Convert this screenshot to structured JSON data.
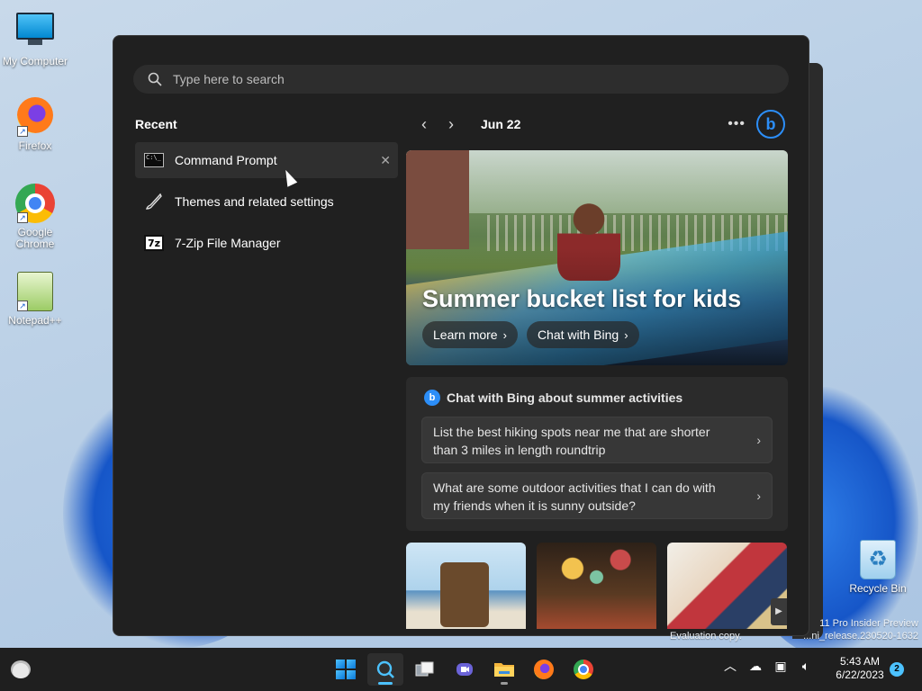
{
  "desktop": {
    "icons": [
      {
        "label": "My Computer",
        "icon": "computer-icon"
      },
      {
        "label": "Firefox",
        "icon": "firefox-icon"
      },
      {
        "label": "Google Chrome",
        "icon": "chrome-icon"
      },
      {
        "label": "Notepad++",
        "icon": "notepadpp-icon"
      },
      {
        "label": "Recycle Bin",
        "icon": "recycle-bin-icon"
      }
    ],
    "watermark": {
      "line1": "11 Pro Insider Preview",
      "line2": "...ni_release.230520-1632",
      "eval": "Evaluation copy."
    }
  },
  "search": {
    "placeholder": "Type here to search"
  },
  "recent": {
    "title": "Recent",
    "items": [
      {
        "label": "Command Prompt",
        "icon": "command-prompt-icon"
      },
      {
        "label": "Themes and related settings",
        "icon": "brush-icon"
      },
      {
        "label": "7-Zip File Manager",
        "icon": "seven-zip-icon",
        "badge": "7z"
      }
    ]
  },
  "highlights": {
    "date": "Jun 22",
    "hero": {
      "title": "Summer bucket list for kids",
      "learn_more": "Learn more",
      "chat_with_bing": "Chat with Bing"
    },
    "chat": {
      "heading": "Chat with Bing about summer activities",
      "prompts": [
        "List the best hiking spots near me that are shorter than 3 miles in length roundtrip",
        "What are some outdoor activities that I can do with my friends when it is sunny outside?"
      ]
    }
  },
  "taskbar": {
    "time": "5:43 AM",
    "date": "6/22/2023",
    "notifications": "2",
    "accent": "#4cc2ff"
  }
}
